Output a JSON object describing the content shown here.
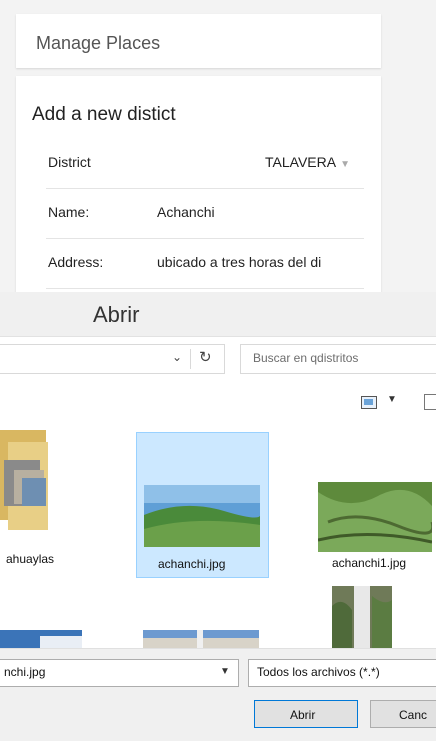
{
  "app": {
    "header_title": "Manage Places",
    "form_title": "Add a new distict",
    "fields": [
      {
        "label": "District",
        "value": "TALAVERA"
      },
      {
        "label": "Name:",
        "value": "Achanchi"
      },
      {
        "label": "Address:",
        "value": "ubicado a tres horas del di"
      }
    ]
  },
  "dialog": {
    "title": "Abrir",
    "search_placeholder": "Buscar en qdistritos",
    "files": [
      {
        "name": "ahuaylas"
      },
      {
        "name": "achanchi.jpg",
        "selected": true
      },
      {
        "name": "achanchi1.jpg"
      }
    ],
    "file_name_value": "nchi.jpg",
    "file_type_value": "Todos los archivos (*.*)",
    "open_button": "Abrir",
    "cancel_button": "Canc"
  },
  "icons": [
    "chevron-down-icon",
    "refresh-icon",
    "view-mode-icon",
    "folder-icon",
    "preview-pane-icon"
  ],
  "colors": {
    "selection": "#cce8ff",
    "selection_border": "#99d1ff",
    "dialog_bg": "#f0f0f0",
    "primary_border": "#0078d7"
  }
}
